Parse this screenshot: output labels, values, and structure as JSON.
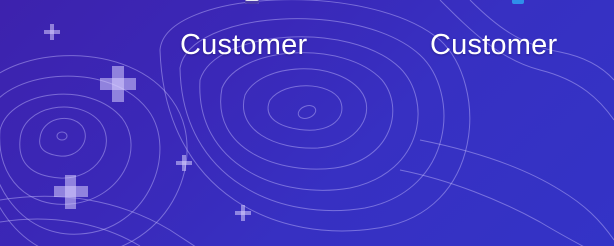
{
  "desktop": {
    "icons": [
      {
        "label": "Customer"
      },
      {
        "label": "Customer"
      }
    ]
  }
}
